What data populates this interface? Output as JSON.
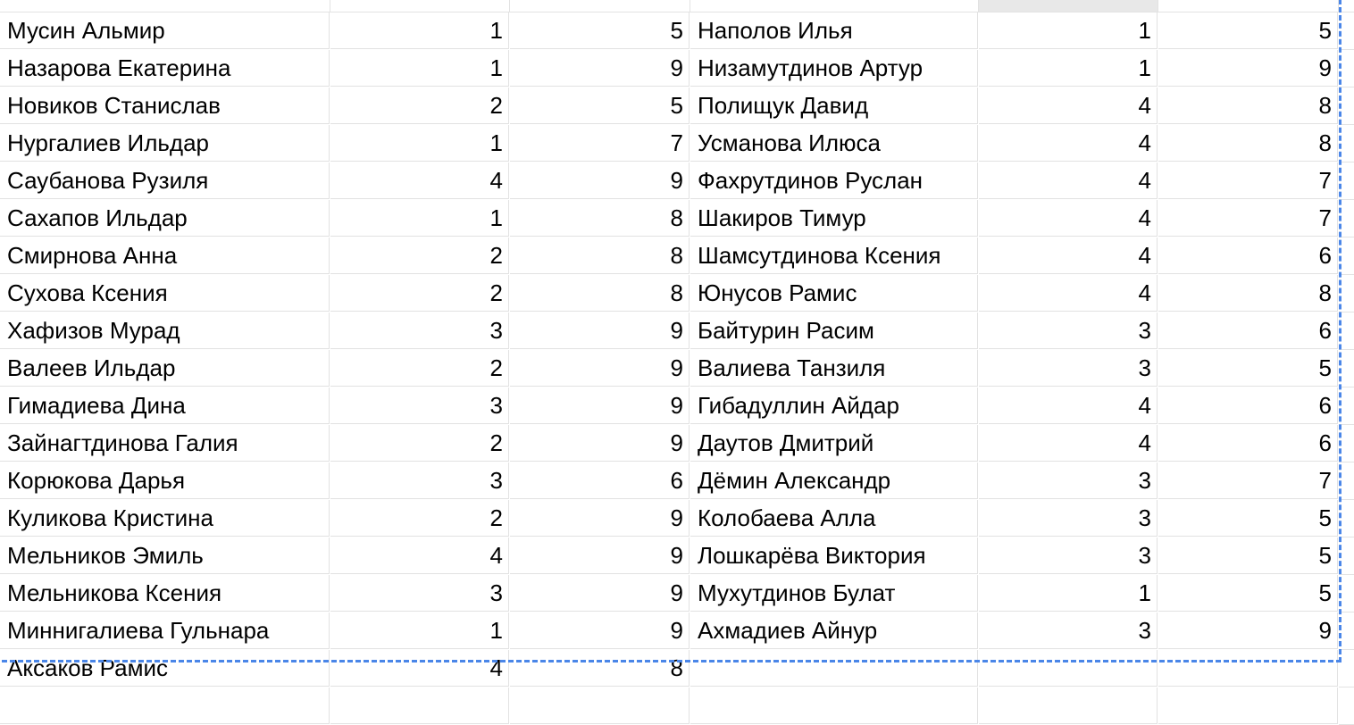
{
  "accent_color": "#4a86e8",
  "rows": [
    {
      "name1": "Мусин Альмир",
      "a1": "1",
      "b1": "5",
      "name2": "Наполов Илья",
      "a2": "1",
      "b2": "5"
    },
    {
      "name1": "Назарова Екатерина",
      "a1": "1",
      "b1": "9",
      "name2": "Низамутдинов Артур",
      "a2": "1",
      "b2": "9"
    },
    {
      "name1": "Новиков Станислав",
      "a1": "2",
      "b1": "5",
      "name2": "Полищук Давид",
      "a2": "4",
      "b2": "8"
    },
    {
      "name1": "Нургалиев Ильдар",
      "a1": "1",
      "b1": "7",
      "name2": "Усманова Илюса",
      "a2": "4",
      "b2": "8"
    },
    {
      "name1": "Саубанова Рузиля",
      "a1": "4",
      "b1": "9",
      "name2": "Фахрутдинов Руслан",
      "a2": "4",
      "b2": "7"
    },
    {
      "name1": "Сахапов Ильдар",
      "a1": "1",
      "b1": "8",
      "name2": "Шакиров Тимур",
      "a2": "4",
      "b2": "7"
    },
    {
      "name1": "Смирнова Анна",
      "a1": "2",
      "b1": "8",
      "name2": "Шамсутдинова Ксения",
      "a2": "4",
      "b2": "6"
    },
    {
      "name1": "Сухова Ксения",
      "a1": "2",
      "b1": "8",
      "name2": "Юнусов Рамис",
      "a2": "4",
      "b2": "8"
    },
    {
      "name1": "Хафизов Мурад",
      "a1": "3",
      "b1": "9",
      "name2": "Байтурин Расим",
      "a2": "3",
      "b2": "6"
    },
    {
      "name1": "Валеев Ильдар",
      "a1": "2",
      "b1": "9",
      "name2": "Валиева Танзиля",
      "a2": "3",
      "b2": "5"
    },
    {
      "name1": "Гимадиева Дина",
      "a1": "3",
      "b1": "9",
      "name2": "Гибадуллин Айдар",
      "a2": "4",
      "b2": "6"
    },
    {
      "name1": "Зайнагтдинова Галия",
      "a1": "2",
      "b1": "9",
      "name2": "Даутов Дмитрий",
      "a2": "4",
      "b2": "6"
    },
    {
      "name1": "Корюкова Дарья",
      "a1": "3",
      "b1": "6",
      "name2": "Дёмин Александр",
      "a2": "3",
      "b2": "7"
    },
    {
      "name1": "Куликова Кристина",
      "a1": "2",
      "b1": "9",
      "name2": "Колобаева Алла",
      "a2": "3",
      "b2": "5"
    },
    {
      "name1": "Мельников Эмиль",
      "a1": "4",
      "b1": "9",
      "name2": "Лошкарёва Виктория",
      "a2": "3",
      "b2": "5"
    },
    {
      "name1": "Мельникова Ксения",
      "a1": "3",
      "b1": "9",
      "name2": "Мухутдинов Булат",
      "a2": "1",
      "b2": "5"
    },
    {
      "name1": "Миннигалиева Гульнара",
      "a1": "1",
      "b1": "9",
      "name2": "Ахмадиев Айнур",
      "a2": "3",
      "b2": "9"
    },
    {
      "name1": "Аксаков Рамис",
      "a1": "4",
      "b1": "8",
      "name2": "",
      "a2": "",
      "b2": ""
    },
    {
      "name1": "",
      "a1": "",
      "b1": "",
      "name2": "",
      "a2": "",
      "b2": ""
    }
  ]
}
